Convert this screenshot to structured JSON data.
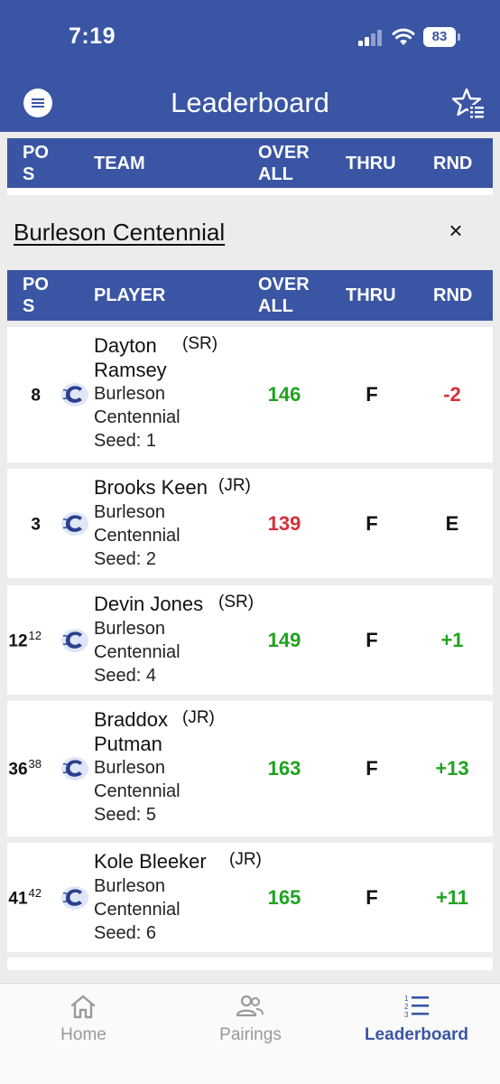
{
  "status_bar": {
    "time": "7:19",
    "battery": "83"
  },
  "app_bar": {
    "title": "Leaderboard",
    "menu_icon": "menu-icon",
    "favorites_icon": "star-list-icon"
  },
  "team_table_header": {
    "pos": "PO\nS",
    "team": "TEAM",
    "overall": "OVER\nALL",
    "thru": "THRU",
    "rnd": "RND"
  },
  "selected_team": {
    "name": "Burleson Centennial",
    "close_label": "×"
  },
  "player_table_header": {
    "pos": "PO\nS",
    "player": "PLAYER",
    "overall": "OVER\nALL",
    "thru": "THRU",
    "rnd": "RND"
  },
  "players": [
    {
      "pos": "8",
      "prev_pos": "",
      "first": "Dayton",
      "last": "Ramsey",
      "class": "(SR)",
      "school_line1": "Burleson",
      "school_line2": "Centennial",
      "seed": "Seed: 1",
      "overall": "146",
      "overall_color": "green",
      "thru": "F",
      "rnd": "-2",
      "rnd_color": "red"
    },
    {
      "pos": "3",
      "prev_pos": "",
      "first": "Brooks Keen",
      "last": "",
      "class": "(JR)",
      "school_line1": "Burleson",
      "school_line2": "Centennial",
      "seed": "Seed: 2",
      "overall": "139",
      "overall_color": "red",
      "thru": "F",
      "rnd": "E",
      "rnd_color": "black"
    },
    {
      "pos": "12",
      "prev_pos": "12",
      "first": "Devin Jones",
      "last": "",
      "class": "(SR)",
      "school_line1": "Burleson",
      "school_line2": "Centennial",
      "seed": "Seed: 4",
      "overall": "149",
      "overall_color": "green",
      "thru": "F",
      "rnd": "+1",
      "rnd_color": "green"
    },
    {
      "pos": "36",
      "prev_pos": "38",
      "first": "Braddox",
      "last": "Putman",
      "class": "(JR)",
      "school_line1": "Burleson",
      "school_line2": "Centennial",
      "seed": "Seed: 5",
      "overall": "163",
      "overall_color": "green",
      "thru": "F",
      "rnd": "+13",
      "rnd_color": "green"
    },
    {
      "pos": "41",
      "prev_pos": "42",
      "first": "Kole Bleeker",
      "last": "",
      "class": "(JR)",
      "school_line1": "Burleson",
      "school_line2": "Centennial",
      "seed": "Seed: 6",
      "overall": "165",
      "overall_color": "green",
      "thru": "F",
      "rnd": "+11",
      "rnd_color": "green"
    }
  ],
  "tab_bar": [
    {
      "label": "Home",
      "icon": "home-icon",
      "active": false
    },
    {
      "label": "Pairings",
      "icon": "people-icon",
      "active": false
    },
    {
      "label": "Leaderboard",
      "icon": "ranked-list-icon",
      "active": true
    }
  ],
  "colors": {
    "primary": "#3a55a4",
    "positive": "#1fa320",
    "negative": "#d63038"
  }
}
